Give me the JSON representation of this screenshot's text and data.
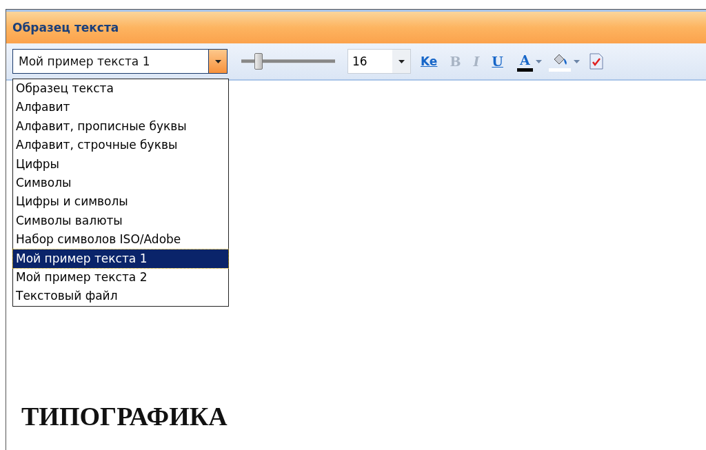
{
  "window": {
    "title": "Образец текста"
  },
  "toolbar": {
    "sample_select": {
      "value": "Мой пример текста 1",
      "expanded": true
    },
    "size_slider": {
      "level": 0.15
    },
    "size_select": {
      "value": "16"
    },
    "buttons": [
      {
        "kind": "kerning",
        "label": "Ke",
        "disabled": false
      },
      {
        "kind": "bold",
        "label": "B",
        "disabled": true
      },
      {
        "kind": "italic",
        "label": "I",
        "disabled": true
      },
      {
        "kind": "underline",
        "label": "U",
        "disabled": false
      },
      {
        "kind": "font-color",
        "label": "A",
        "disabled": false,
        "color": "#000000"
      },
      {
        "kind": "fill-color",
        "disabled": false,
        "color": "#ffffff"
      },
      {
        "kind": "check",
        "disabled": false
      }
    ]
  },
  "dropdown": {
    "items": [
      {
        "label": "Образец текста",
        "selected": false
      },
      {
        "label": "Алфавит",
        "selected": false
      },
      {
        "label": "Алфавит, прописные буквы",
        "selected": false
      },
      {
        "label": "Алфавит, строчные буквы",
        "selected": false
      },
      {
        "label": "Цифры",
        "selected": false
      },
      {
        "label": "Символы",
        "selected": false
      },
      {
        "label": "Цифры и символы",
        "selected": false
      },
      {
        "label": "Символы валюты",
        "selected": false
      },
      {
        "label": "Набор символов ISO/Adobe",
        "selected": false
      },
      {
        "label": "Мой пример текста 1",
        "selected": true
      },
      {
        "label": "Мой пример текста 2",
        "selected": false
      },
      {
        "label": "Текстовый файл",
        "selected": false
      }
    ]
  },
  "preview": {
    "text": "ТИПОГРАФИКА"
  }
}
